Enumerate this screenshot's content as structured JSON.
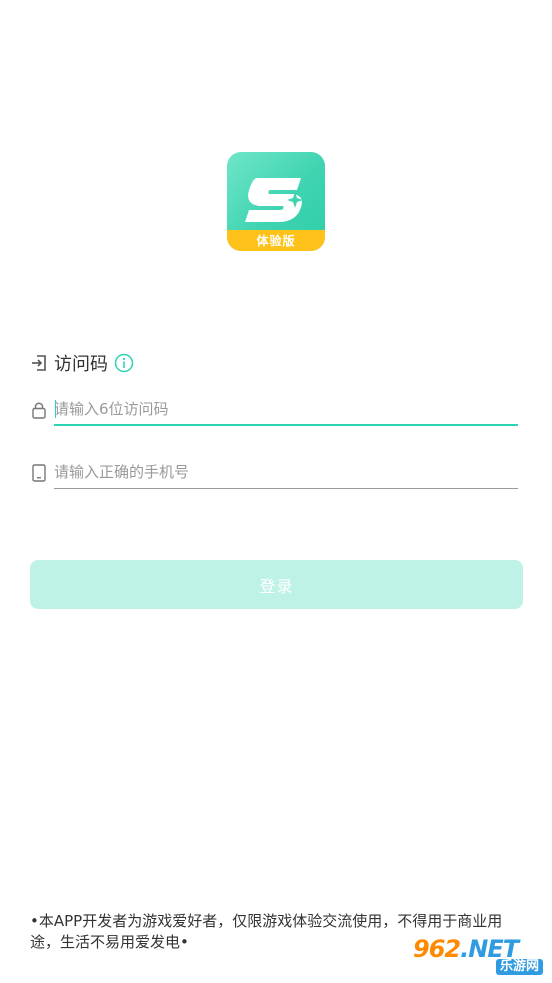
{
  "app": {
    "logo_icon": "app-logo-s-icon",
    "logo_badge": "体验版",
    "brand_color": "#3fd4b1",
    "badge_color": "#ffc21a"
  },
  "section": {
    "label": "访问码",
    "label_icon": "login-arrow-icon",
    "info_icon": "info-circle-icon"
  },
  "fields": {
    "access_code": {
      "placeholder": "请输入6位访问码",
      "value": "",
      "icon": "lock-icon"
    },
    "phone": {
      "placeholder": "请输入正确的手机号",
      "value": "",
      "icon": "phone-icon"
    }
  },
  "login_button": {
    "label": "登录",
    "color": "#bff2e6"
  },
  "disclaimer": {
    "text": "•本APP开发者为游戏爱好者，仅限游戏体验交流使用，不得用于商业用途，生活不易用爱发电•"
  },
  "watermark": {
    "main": "962",
    "suffix": ".NET",
    "sub": "乐游网"
  },
  "colors": {
    "accent": "#2ed3b3",
    "placeholder": "#9a9a9a",
    "text": "#333333"
  }
}
